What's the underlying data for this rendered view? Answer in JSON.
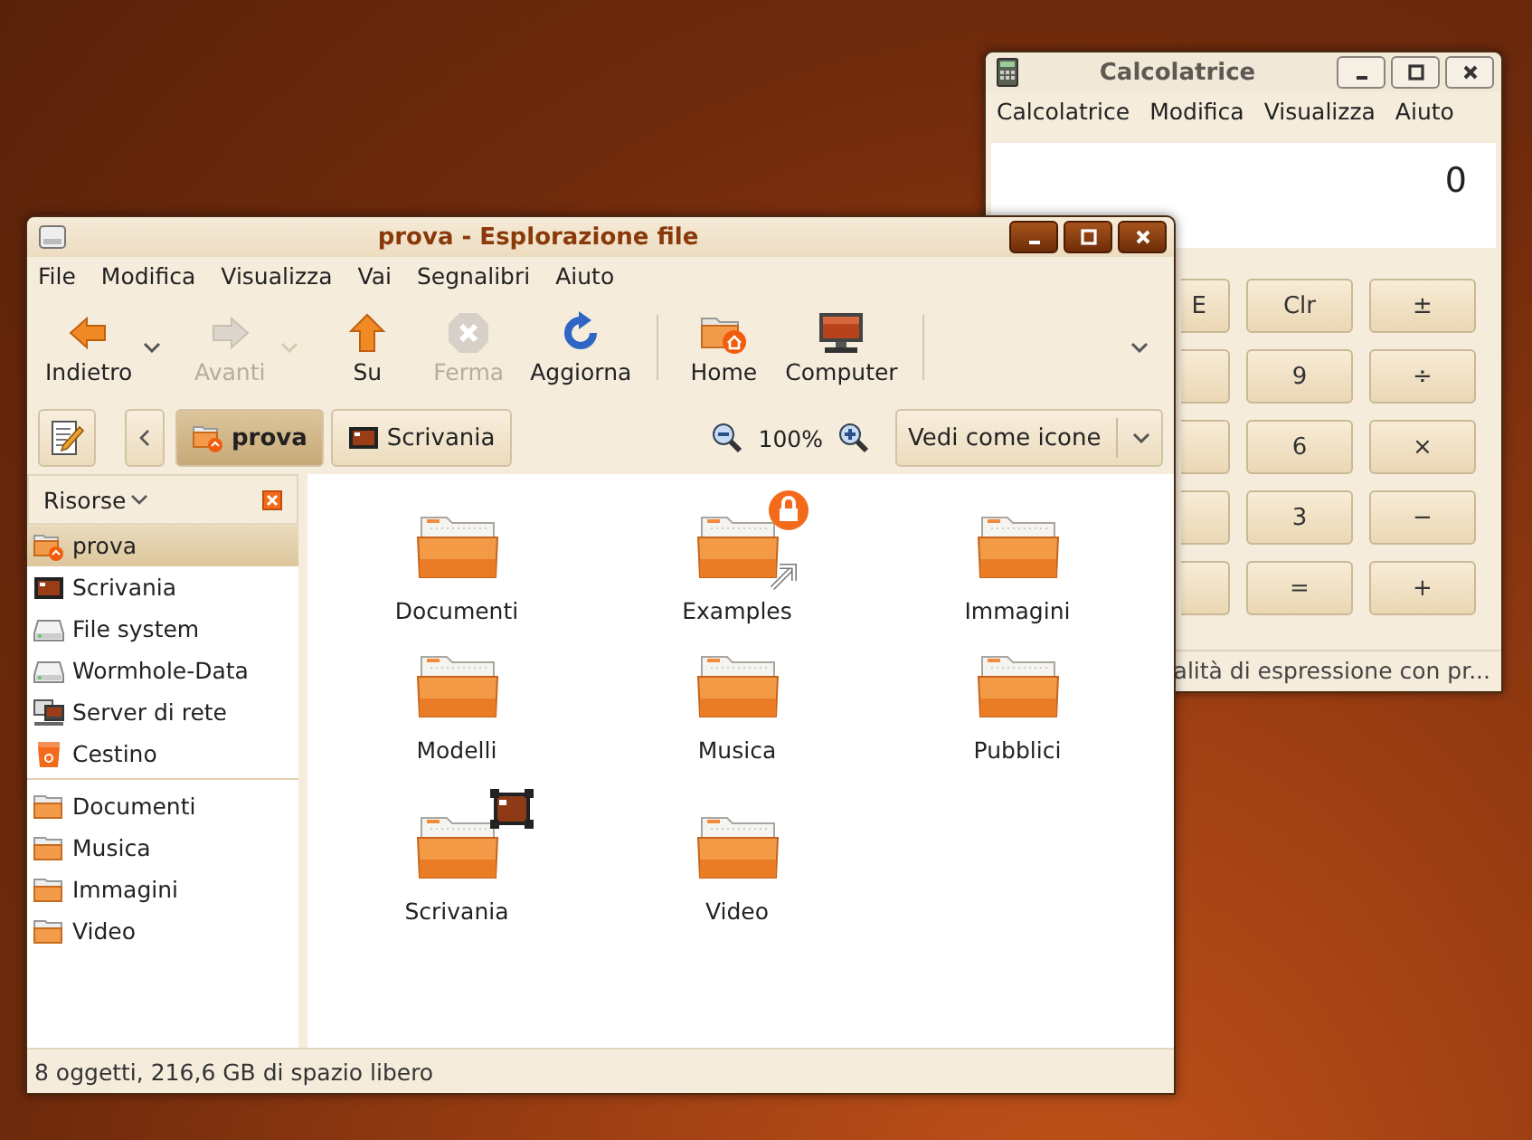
{
  "calculator": {
    "title": "Calcolatrice",
    "active": false,
    "menu": [
      "Calcolatrice",
      "Modifica",
      "Visualizza",
      "Aiuto"
    ],
    "display": "0",
    "keys": [
      {
        "label": "E",
        "kind": "cut"
      },
      {
        "label": "Clr",
        "kind": "full"
      },
      {
        "label": "±",
        "kind": "full"
      },
      {
        "kind": "cut"
      },
      {
        "label": "9",
        "kind": "full"
      },
      {
        "label": "÷",
        "kind": "full"
      },
      {
        "kind": "cut"
      },
      {
        "label": "6",
        "kind": "full"
      },
      {
        "label": "×",
        "kind": "full"
      },
      {
        "kind": "cut"
      },
      {
        "label": "3",
        "kind": "full"
      },
      {
        "label": "−",
        "kind": "full"
      },
      {
        "kind": "cut"
      },
      {
        "label": "=",
        "kind": "full"
      },
      {
        "label": "+",
        "kind": "full"
      }
    ],
    "status": "alità di espressione con pr..."
  },
  "file_manager": {
    "title": "prova - Esplorazione file",
    "active": true,
    "menu": [
      "File",
      "Modifica",
      "Visualizza",
      "Vai",
      "Segnalibri",
      "Aiuto"
    ],
    "toolbar": [
      {
        "label": "Indietro",
        "kind": "back",
        "disabled": false,
        "menu": true
      },
      {
        "label": "Avanti",
        "kind": "forward",
        "disabled": true,
        "menu": true
      },
      {
        "label": "Su",
        "kind": "up",
        "disabled": false,
        "menu": false
      },
      {
        "label": "Ferma",
        "kind": "stop",
        "disabled": true,
        "menu": false
      },
      {
        "label": "Aggiorna",
        "kind": "reload",
        "disabled": false,
        "menu": false
      },
      {
        "label": "Home",
        "kind": "home",
        "disabled": false,
        "menu": false
      },
      {
        "label": "Computer",
        "kind": "computer",
        "disabled": false,
        "menu": false
      }
    ],
    "path": [
      {
        "label": "prova",
        "kind": "home",
        "selected": true
      },
      {
        "label": "Scrivania",
        "kind": "desktop",
        "selected": false
      }
    ],
    "zoom": "100%",
    "view": "Vedi come icone",
    "sidebar": {
      "title": "Risorse",
      "places": [
        {
          "label": "prova",
          "kind": "home",
          "selected": true
        },
        {
          "label": "Scrivania",
          "kind": "desktop",
          "selected": false
        },
        {
          "label": "File system",
          "kind": "drive",
          "selected": false
        },
        {
          "label": "Wormhole-Data",
          "kind": "drive",
          "selected": false
        },
        {
          "label": "Server di rete",
          "kind": "network",
          "selected": false
        },
        {
          "label": "Cestino",
          "kind": "trash",
          "selected": false
        }
      ],
      "bookmarks": [
        {
          "label": "Documenti",
          "kind": "folder",
          "selected": false
        },
        {
          "label": "Musica",
          "kind": "folder",
          "selected": false
        },
        {
          "label": "Immagini",
          "kind": "folder",
          "selected": false
        },
        {
          "label": "Video",
          "kind": "folder",
          "selected": false
        }
      ]
    },
    "items": [
      {
        "name": "Documenti",
        "kind": "folder",
        "locked": false,
        "symlink": false
      },
      {
        "name": "Examples",
        "kind": "folder",
        "locked": true,
        "symlink": true
      },
      {
        "name": "Immagini",
        "kind": "folder",
        "locked": false,
        "symlink": false
      },
      {
        "name": "Modelli",
        "kind": "folder",
        "locked": false,
        "symlink": false
      },
      {
        "name": "Musica",
        "kind": "folder",
        "locked": false,
        "symlink": false
      },
      {
        "name": "Pubblici",
        "kind": "folder",
        "locked": false,
        "symlink": false
      },
      {
        "name": "Scrivania",
        "kind": "desktop",
        "locked": false,
        "symlink": false
      },
      {
        "name": "Video",
        "kind": "folder",
        "locked": false,
        "symlink": false
      }
    ],
    "status": "8 oggetti, 216,6 GB di spazio libero"
  }
}
